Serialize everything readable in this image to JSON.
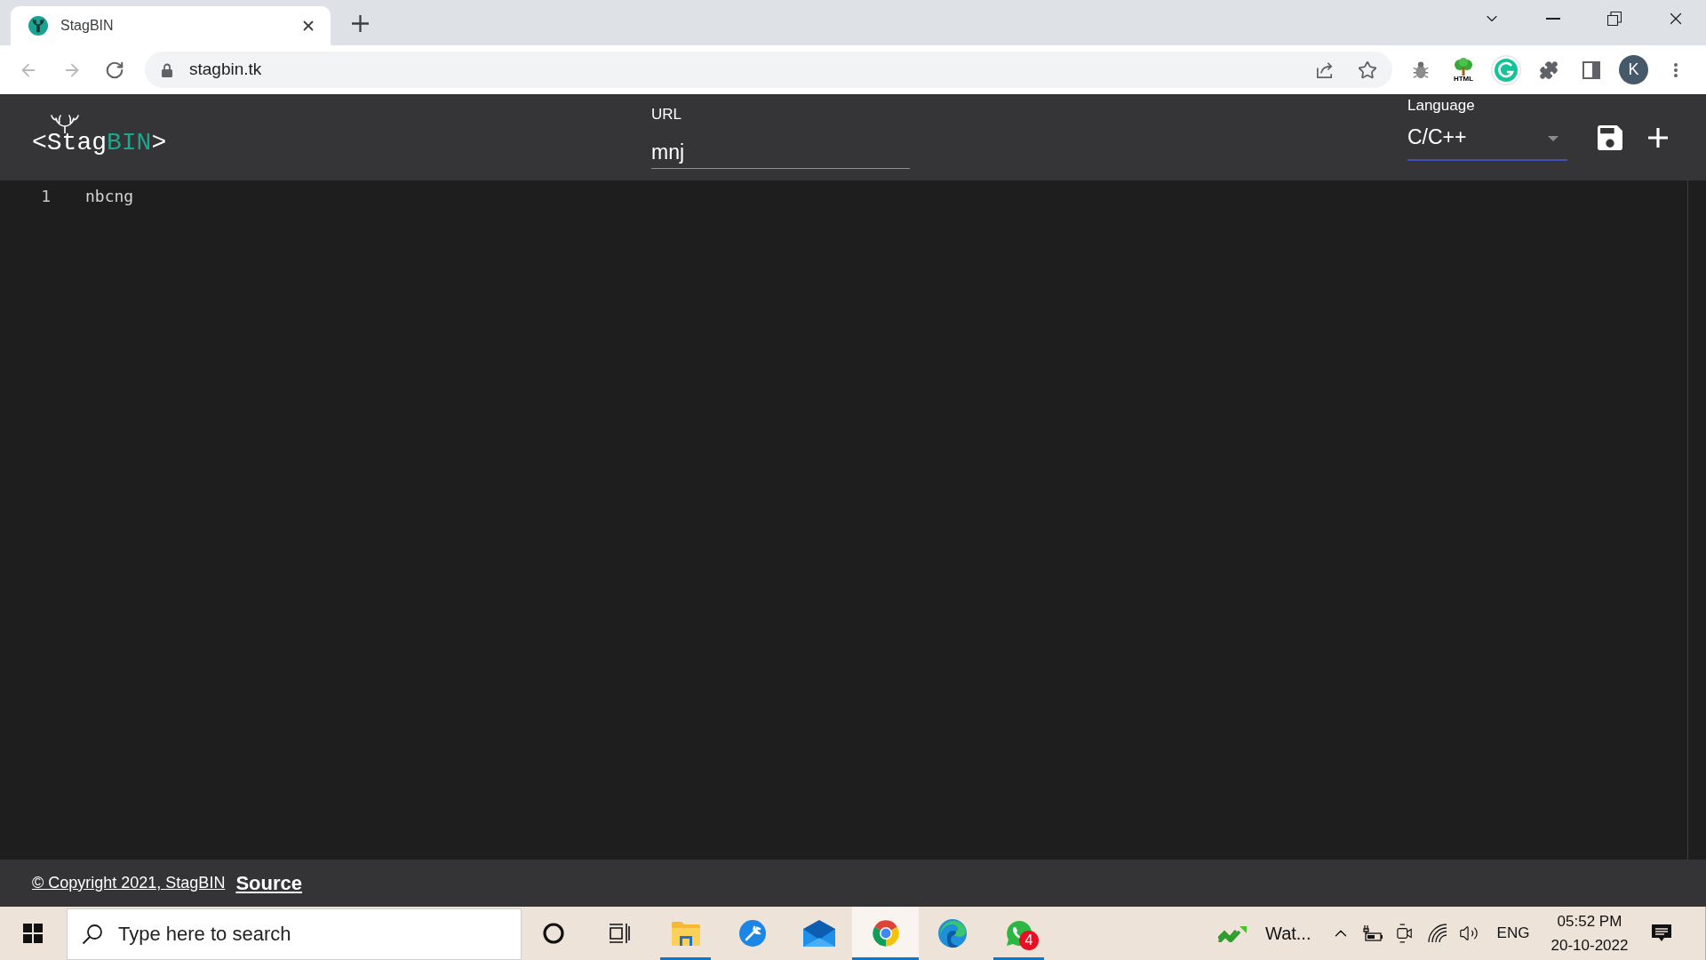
{
  "browser": {
    "tabs": [
      {
        "title": "StagBIN",
        "selected": true
      }
    ],
    "address": "stagbin.tk",
    "extension_label": "HTML",
    "profile_initial": "K"
  },
  "app": {
    "logo": {
      "lead": "<Stag",
      "accent": "BIN",
      "tail": ">"
    },
    "url_field": {
      "label": "URL",
      "value": "mnj"
    },
    "language_select": {
      "label": "Language",
      "value": "C/C++"
    }
  },
  "editor": {
    "lines": [
      {
        "number": "1",
        "text": "nbcng"
      }
    ]
  },
  "footer": {
    "copyright": "© Copyright 2021, StagBIN",
    "source_link": "Source"
  },
  "taskbar": {
    "search": {
      "placeholder": "Type here to search"
    },
    "apps": [
      {
        "kind": "folder",
        "running": true,
        "selected": false
      },
      {
        "kind": "wrench",
        "running": false,
        "selected": false
      },
      {
        "kind": "mail",
        "running": false,
        "selected": false
      },
      {
        "kind": "browser",
        "running": true,
        "selected": true
      },
      {
        "kind": "wave-browser",
        "running": false,
        "selected": false
      },
      {
        "kind": "chat",
        "running": true,
        "selected": false,
        "badge": "4"
      }
    ],
    "widget": {
      "label": "Wat..."
    },
    "input_language": "ENG",
    "time": "05:52 PM",
    "date": "20-10-2022"
  }
}
